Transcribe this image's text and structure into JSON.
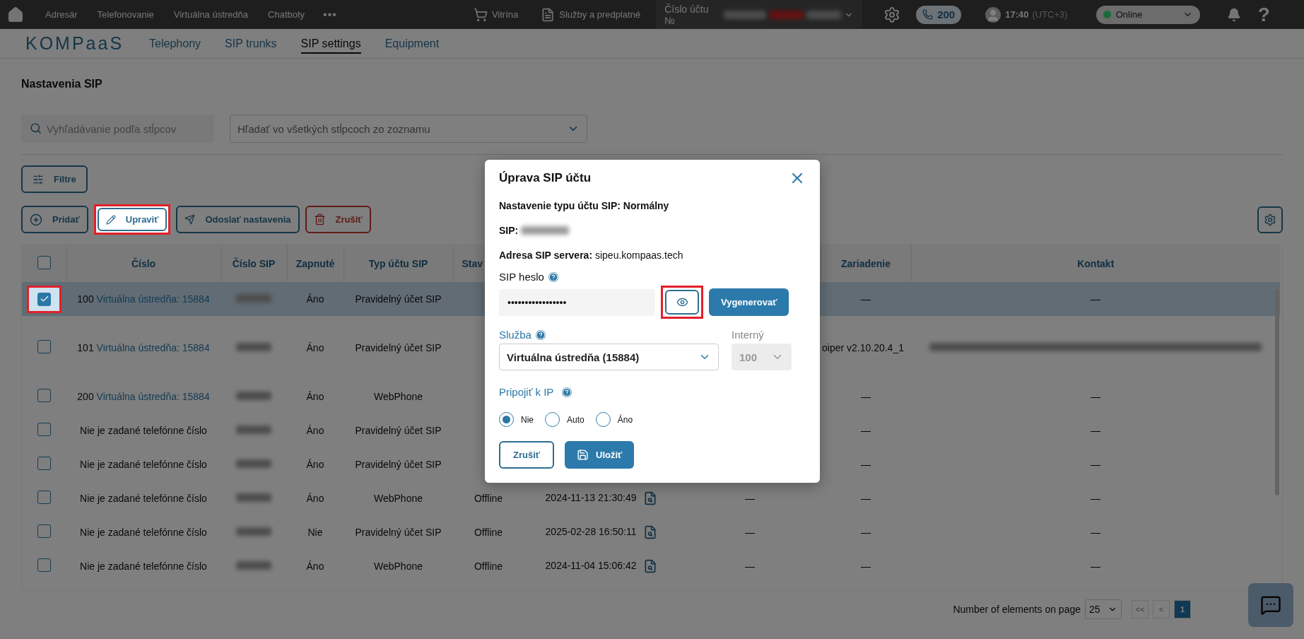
{
  "topbar": {
    "menu": [
      {
        "label": "Adresár"
      },
      {
        "label": "Telefonovanie"
      },
      {
        "label": "Virtuálna ústredňa"
      },
      {
        "label": "Chatboty"
      }
    ],
    "more": "•••",
    "shop": "Vitrína",
    "services": "Služby a predplatné",
    "account_label": "Číslo účtu №",
    "calls": "200",
    "time": "17:40",
    "timezone": "(UTC+3)",
    "status": {
      "label": "Online",
      "color": "#1b6b3a"
    },
    "help": "?"
  },
  "nav": {
    "logo": "KOMPaaS",
    "tabs": [
      {
        "label": "Telephony",
        "selected": false
      },
      {
        "label": "SIP trunks",
        "selected": false
      },
      {
        "label": "SIP settings",
        "selected": true
      },
      {
        "label": "Equipment",
        "selected": false
      }
    ]
  },
  "page": {
    "title": "Nastavenia SIP",
    "search": {
      "placeholder": "Vyhľadávanie podľa stĺpcov"
    },
    "column_select": {
      "placeholder": "Hľadať vo všetkých stĺpcoch zo zoznamu"
    },
    "filter_button": "Filtre",
    "actions": [
      {
        "kind": "add",
        "label": "Pridať",
        "highlighted": false
      },
      {
        "kind": "edit",
        "label": "Upraviť",
        "highlighted": true
      },
      {
        "kind": "send",
        "label": "Odoslať nastavenia",
        "highlighted": false
      },
      {
        "kind": "delete",
        "label": "Zrušiť",
        "highlighted": false
      }
    ]
  },
  "table": {
    "headers": {
      "number": "Číslo",
      "sip": "Číslo SIP",
      "enabled": "Zapnuté",
      "type": "Typ účtu SIP",
      "status": "Stav",
      "device": "Zariadenie",
      "contact": "Kontakt"
    },
    "select_all_checked": false,
    "rows": [
      {
        "selected": true,
        "checked": true,
        "highlighted": true,
        "number": "100",
        "link": "Virtuálna ústredňa: 15884",
        "enabled": "Áno",
        "type": "Pravidelný účet SIP",
        "device": "—",
        "contact": "—"
      },
      {
        "selected": false,
        "checked": false,
        "number": "101",
        "link": "Virtuálna ústredňa: 15884",
        "enabled": "Áno",
        "type": "Pravidelný účet SIP",
        "device": "oiper v2.10.20.4_1",
        "contact_blurred": true
      },
      {
        "selected": false,
        "checked": false,
        "number": "200",
        "link": "Virtuálna ústredňa: 15884",
        "enabled": "Áno",
        "type": "WebPhone",
        "device": "—",
        "contact": "—"
      },
      {
        "selected": false,
        "checked": false,
        "number": "Nie je zadané telefónne číslo",
        "enabled": "Áno",
        "type": "Pravidelný účet SIP",
        "device": "—",
        "contact": "—"
      },
      {
        "selected": false,
        "checked": false,
        "number": "Nie je zadané telefónne číslo",
        "enabled": "Áno",
        "type": "Pravidelný účet SIP",
        "device": "—",
        "contact": "—"
      },
      {
        "selected": false,
        "checked": false,
        "number": "Nie je zadané telefónne číslo",
        "enabled": "Áno",
        "type": "WebPhone",
        "status": "Offline",
        "date": "2024-11-13 21:30:49",
        "column_7": "—",
        "device": "—",
        "contact": "—"
      },
      {
        "selected": false,
        "checked": false,
        "number": "Nie je zadané telefónne číslo",
        "enabled": "Nie",
        "type": "Pravidelný účet SIP",
        "status": "Offline",
        "date": "2025-02-28 16:50:11",
        "column_7": "—",
        "device": "—",
        "contact": "—"
      },
      {
        "selected": false,
        "checked": false,
        "number": "Nie je zadané telefónne číslo",
        "enabled": "Áno",
        "type": "WebPhone",
        "status": "Offline",
        "date": "2024-11-04 15:06:42",
        "column_7": "—",
        "device": "—",
        "contact": "—"
      }
    ]
  },
  "footer": {
    "page_size_label": "Number of elements on page",
    "page_size": "25",
    "pager": [
      {
        "label": "<<",
        "selected": false
      },
      {
        "label": "<",
        "selected": false
      },
      {
        "label": "1",
        "selected": true
      }
    ]
  },
  "dialog": {
    "title": "Úprava SIP účtu",
    "account_type": "Nastavenie typu účtu SIP: Normálny",
    "sip_label": "SIP:",
    "server": "**Adresa SIP servera:** sipeu.kompaas.tech",
    "password": {
      "label": "SIP heslo",
      "value": "•••••••••••••••••"
    },
    "reveal_highlighted": true,
    "generate": "Vygenerovať",
    "service": {
      "label": "Služba",
      "value": "Virtuálna ústredňa (15884)"
    },
    "internal": {
      "label": "Interný",
      "value": "100",
      "disabled": true
    },
    "connect_ip": {
      "label": "Pripojiť k IP",
      "options": [
        {
          "label": "Nie",
          "selected": true
        },
        {
          "label": "Auto",
          "selected": false
        },
        {
          "label": "Áno",
          "selected": false
        }
      ]
    },
    "buttons": [
      {
        "kind": "cancel",
        "label": "Zrušiť"
      },
      {
        "kind": "save",
        "label": "Uložiť"
      }
    ]
  }
}
